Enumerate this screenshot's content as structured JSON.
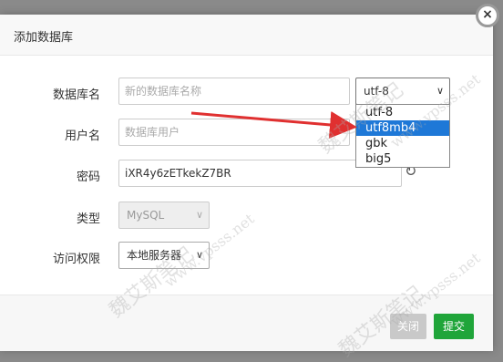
{
  "dialog": {
    "title": "添加数据库",
    "close_symbol": "×"
  },
  "form": {
    "db_name": {
      "label": "数据库名",
      "value": "",
      "placeholder": "新的数据库名称"
    },
    "charset": {
      "selected": "utf-8",
      "options": [
        "utf-8",
        "utf8mb4",
        "gbk",
        "big5"
      ],
      "highlighted": "utf8mb4"
    },
    "username": {
      "label": "用户名",
      "value": "",
      "placeholder": "数据库用户"
    },
    "password": {
      "label": "密码",
      "value": "iXR4y6zETkekZ7BR"
    },
    "type": {
      "label": "类型",
      "value": "MySQL"
    },
    "access": {
      "label": "访问权限",
      "value": "本地服务器"
    }
  },
  "footer": {
    "close_label": "关闭",
    "submit_label": "提交"
  },
  "watermark": {
    "text1": "魏艾斯笔记",
    "text2": "www.vpsss.net"
  },
  "colors": {
    "submit": "#20a53a",
    "close_button": "#c9c9c9",
    "highlight": "#1e78d7",
    "arrow": "#e03030"
  }
}
